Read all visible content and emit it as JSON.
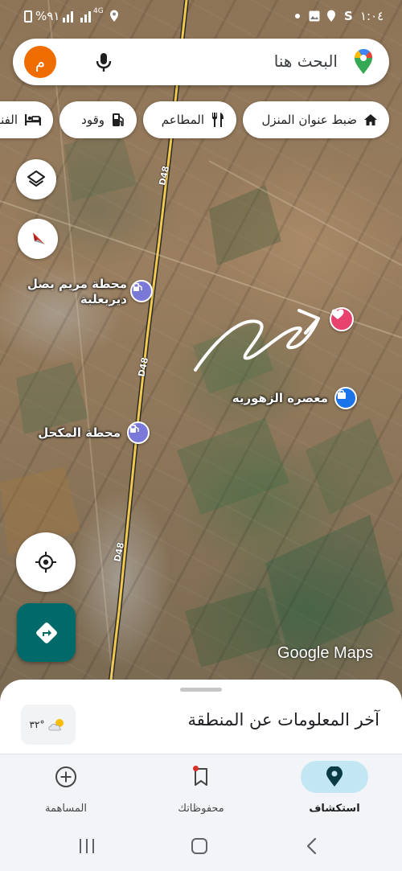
{
  "status_bar": {
    "time": "١:٠٤",
    "battery": "%٩١",
    "network": "4G"
  },
  "search": {
    "placeholder": "البحث هنا",
    "avatar_letter": "م"
  },
  "chips": [
    {
      "label": "ضبط عنوان المنزل",
      "icon": "home-icon"
    },
    {
      "label": "المطاعم",
      "icon": "restaurant-icon"
    },
    {
      "label": "وقود",
      "icon": "gas-station-icon"
    },
    {
      "label": "الفنا",
      "icon": "hotel-icon"
    }
  ],
  "map": {
    "road_labels": [
      "D48",
      "D48",
      "D48"
    ],
    "pois": [
      {
        "name": "محطة مريم بصل\nديربعلبة",
        "type": "gas-station"
      },
      {
        "name": "معصره الزهوريه",
        "type": "shopping"
      },
      {
        "name": "محطة المكحل",
        "type": "gas-station"
      }
    ],
    "watermark": "Google Maps"
  },
  "sheet": {
    "title": "آخر المعلومات عن المنطقة",
    "weather": "٣٢°"
  },
  "nav": {
    "explore": "استكشاف",
    "saved": "محفوظاتك",
    "contribute": "المساهمة"
  },
  "colors": {
    "accent": "#006a6a",
    "avatar": "#ee6c00",
    "poi_gas": "#7b79d8",
    "poi_shop": "#1a73e8",
    "favorite": "#e8436f"
  }
}
